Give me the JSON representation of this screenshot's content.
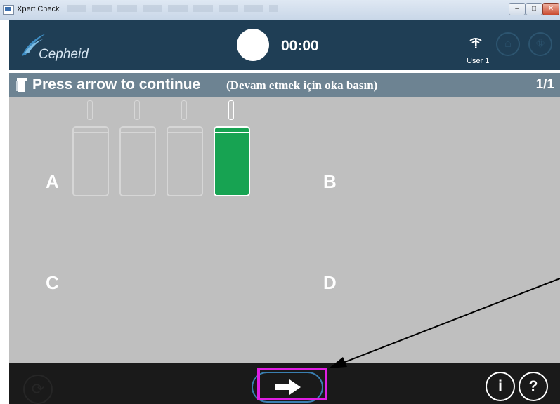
{
  "window": {
    "title": "Xpert Check",
    "controls": [
      "minimize",
      "maximize",
      "close"
    ]
  },
  "header": {
    "brand": "Cepheid",
    "timer": "00:00",
    "user": "User 1",
    "icons": [
      "status-circle",
      "signal-icon",
      "home-icon",
      "exit-icon"
    ]
  },
  "instruction": {
    "text": "Press arrow to continue",
    "translation": "(Devam etmek için oka basın)",
    "page": "1/1"
  },
  "modules": {
    "quadrants": [
      "A",
      "B",
      "C",
      "D"
    ],
    "bays": [
      {
        "id": "A1",
        "state": "empty"
      },
      {
        "id": "A2",
        "state": "empty"
      },
      {
        "id": "A3",
        "state": "empty"
      },
      {
        "id": "A4",
        "state": "active"
      }
    ],
    "colors": {
      "active": "#17a352",
      "inactive": "#d6d6d6",
      "background": "#bfbfbf"
    }
  },
  "footer": {
    "icons": [
      "refresh-icon",
      "arrow-right-icon",
      "info-icon",
      "help-icon"
    ],
    "info_label": "i",
    "help_label": "?"
  },
  "annotation": {
    "highlight_color": "#e01ee3"
  }
}
